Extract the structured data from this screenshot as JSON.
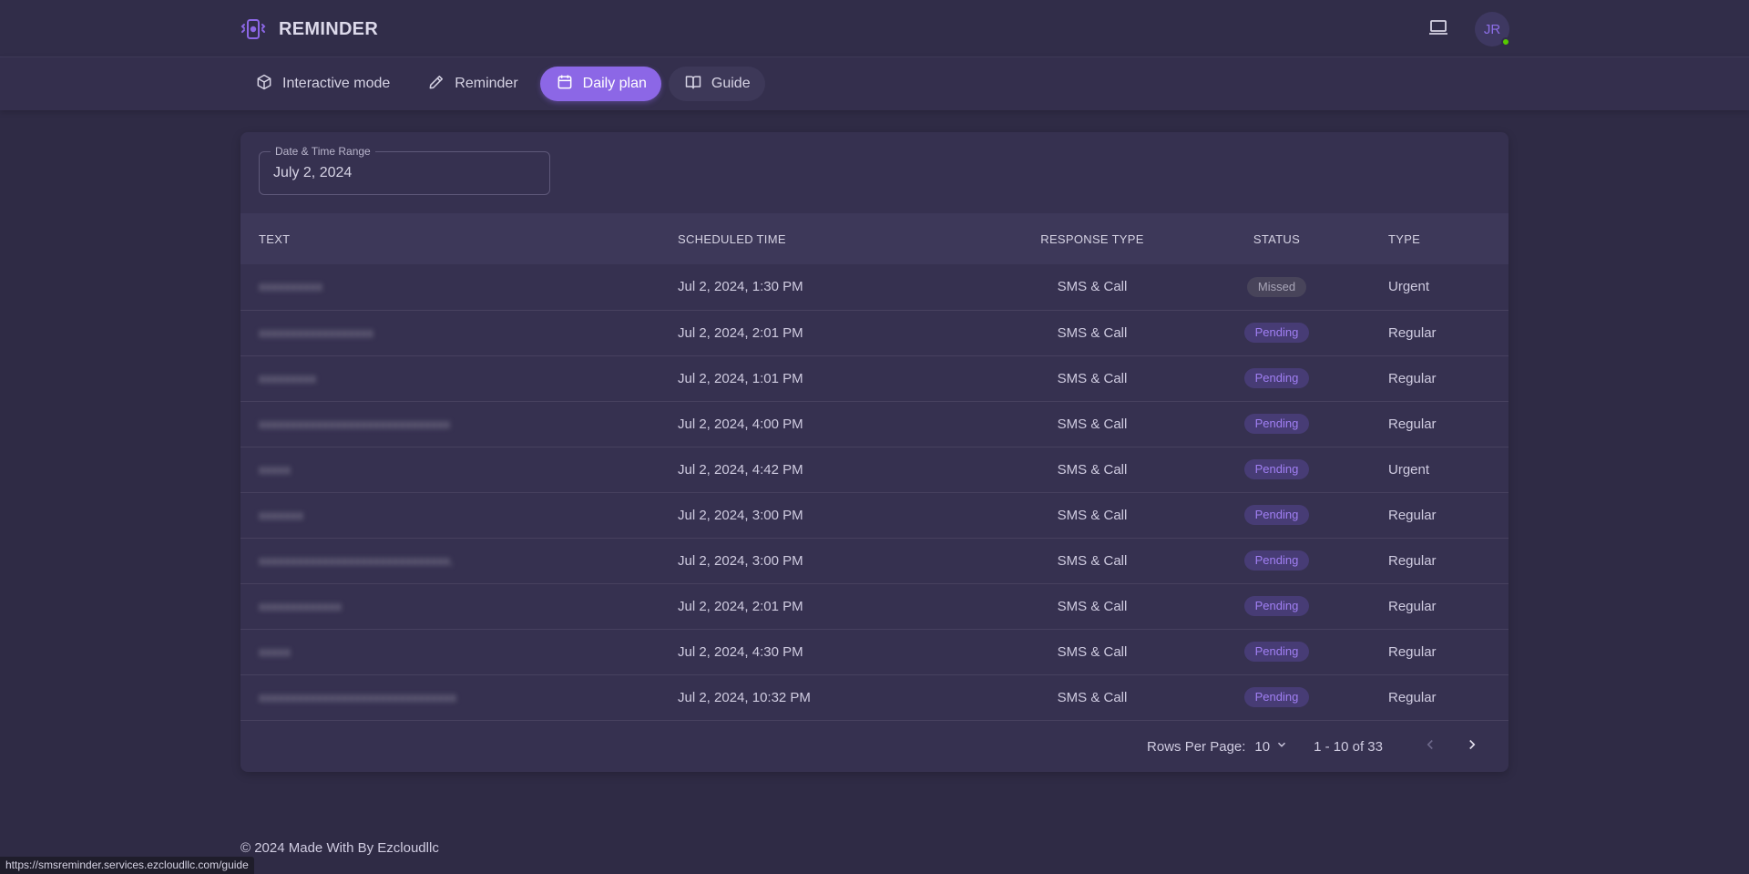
{
  "app": {
    "title": "REMINDER",
    "avatar_initials": "JR"
  },
  "nav": [
    {
      "label": "Interactive mode",
      "icon": "cube-icon"
    },
    {
      "label": "Reminder",
      "icon": "pencil-icon"
    },
    {
      "label": "Daily plan",
      "icon": "calendar-icon"
    },
    {
      "label": "Guide",
      "icon": "book-icon"
    }
  ],
  "filter": {
    "label": "Date & Time Range",
    "value": "July 2, 2024"
  },
  "table": {
    "headers": [
      "TEXT",
      "SCHEDULED TIME",
      "RESPONSE TYPE",
      "STATUS",
      "TYPE"
    ],
    "rows": [
      {
        "text": "xxxxxxxxxx",
        "time": "Jul 2, 2024, 1:30 PM",
        "response": "SMS & Call",
        "status": "Missed",
        "type": "Urgent"
      },
      {
        "text": "xxxxxxxxxxxxxxxxxx",
        "time": "Jul 2, 2024, 2:01 PM",
        "response": "SMS & Call",
        "status": "Pending",
        "type": "Regular"
      },
      {
        "text": "xxxxxxxxx",
        "time": "Jul 2, 2024, 1:01 PM",
        "response": "SMS & Call",
        "status": "Pending",
        "type": "Regular"
      },
      {
        "text": "xxxxxxxxxxxxxxxxxxxxxxxxxxxxxx",
        "time": "Jul 2, 2024, 4:00 PM",
        "response": "SMS & Call",
        "status": "Pending",
        "type": "Regular"
      },
      {
        "text": "xxxxx",
        "time": "Jul 2, 2024, 4:42 PM",
        "response": "SMS & Call",
        "status": "Pending",
        "type": "Urgent"
      },
      {
        "text": "xxxxxxx",
        "time": "Jul 2, 2024, 3:00 PM",
        "response": "SMS & Call",
        "status": "Pending",
        "type": "Regular"
      },
      {
        "text": "xxxxxxxxxxxxxxxxxxxxxxxxxxxxxx.",
        "time": "Jul 2, 2024, 3:00 PM",
        "response": "SMS & Call",
        "status": "Pending",
        "type": "Regular"
      },
      {
        "text": "xxxxxxxxxxxxx",
        "time": "Jul 2, 2024, 2:01 PM",
        "response": "SMS & Call",
        "status": "Pending",
        "type": "Regular"
      },
      {
        "text": "xxxxx",
        "time": "Jul 2, 2024, 4:30 PM",
        "response": "SMS & Call",
        "status": "Pending",
        "type": "Regular"
      },
      {
        "text": "xxxxxxxxxxxxxxxxxxxxxxxxxxxxxxx",
        "time": "Jul 2, 2024, 10:32 PM",
        "response": "SMS & Call",
        "status": "Pending",
        "type": "Regular"
      }
    ]
  },
  "pagination": {
    "rows_per_page_label": "Rows Per Page:",
    "rows_per_page": "10",
    "range": "1 - 10 of 33"
  },
  "footer": {
    "copyright": "© 2024 Made With By Ezcloudllc"
  },
  "statusbar": {
    "url": "https://smsreminder.services.ezcloudllc.com/guide"
  },
  "colors": {
    "accent": "#8c67e6",
    "background": "#2f2b45",
    "card": "#363150",
    "online": "#56ca00"
  }
}
